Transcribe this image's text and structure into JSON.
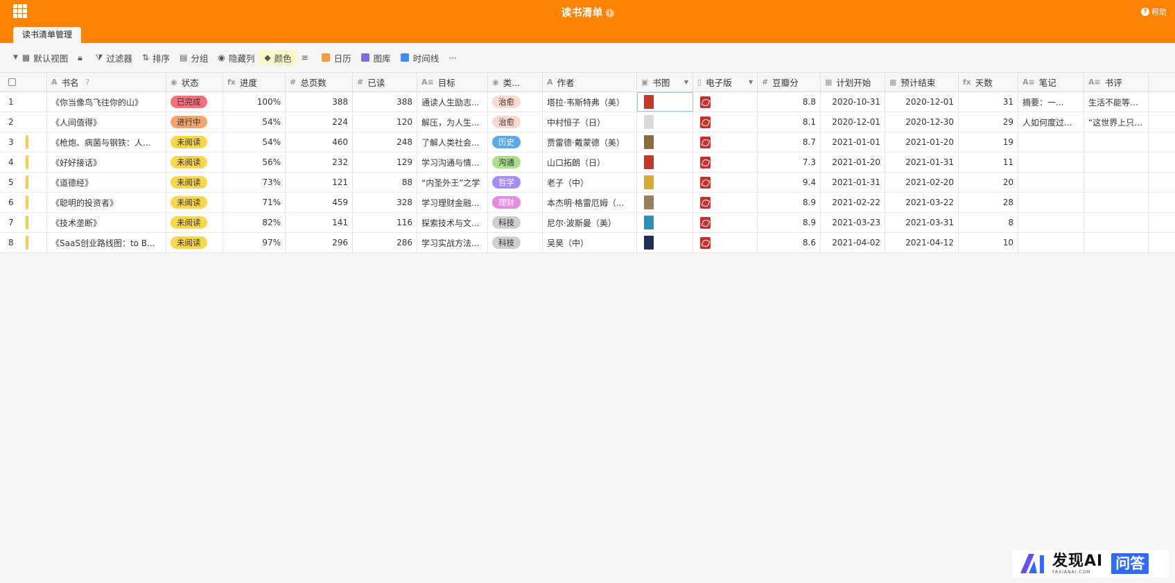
{
  "app": {
    "title": "读书清单",
    "help": "帮助"
  },
  "sheet_tab": "读书清单管理",
  "toolbar": {
    "view": "默认视图",
    "filter": "过滤器",
    "sort": "排序",
    "group": "分组",
    "hide": "隐藏列",
    "color": "颜色",
    "calendar": "日历",
    "gallery": "图库",
    "timeline": "时间线",
    "more": "···"
  },
  "columns": [
    "书名",
    "状态",
    "进度",
    "总页数",
    "已读",
    "目标",
    "类...",
    "作者",
    "书图",
    "电子版",
    "豆瓣分",
    "计划开始",
    "预计结束",
    "天数",
    "笔记",
    "书评"
  ],
  "column_icons": [
    "A",
    "◉",
    "fx",
    "#",
    "#",
    "A≡",
    "◉",
    "A",
    "▣",
    "▯",
    "#",
    "▦",
    "▦",
    "fx",
    "A≡",
    "A≡"
  ],
  "rows": [
    {
      "n": "1",
      "name": "《你当像鸟飞往你的山》",
      "status": "已完成",
      "status_color": "#f4707d",
      "progress": "100%",
      "pages": "388",
      "read": "388",
      "goal": "通读人生励志...",
      "cat": "治愈",
      "cat_color": "#fcd9cf",
      "author": "塔拉·韦斯特弗（美）",
      "thumb": "#c0392b",
      "score": "8.8",
      "start": "2020-10-31",
      "end": "2020-12-01",
      "days": "31",
      "notes": "摘要：一...",
      "review": "生活不能等待别...",
      "mark": false
    },
    {
      "n": "2",
      "name": "《人间值得》",
      "status": "进行中",
      "status_color": "#f4a46c",
      "progress": "54%",
      "pages": "224",
      "read": "120",
      "goal": "解压，为人生...",
      "cat": "治愈",
      "cat_color": "#fcd9cf",
      "author": "中村恒子（日）",
      "thumb": "#d9d9d9",
      "score": "8.1",
      "start": "2020-12-01",
      "end": "2020-12-30",
      "days": "29",
      "notes": "人如何度过...",
      "review": "“这世界上只有...",
      "mark": false
    },
    {
      "n": "3",
      "name": "《枪炮、病菌与钢铁：人...",
      "status": "未阅读",
      "status_color": "#f8d64e",
      "progress": "54%",
      "pages": "460",
      "read": "248",
      "goal": "了解人类社会...",
      "cat": "历史",
      "cat_color": "#5aa9e8",
      "author": "贾雷德·戴蒙德（美）",
      "thumb": "#8a6d3b",
      "score": "8.7",
      "start": "2021-01-01",
      "end": "2021-01-20",
      "days": "19",
      "notes": "",
      "review": "",
      "mark": true
    },
    {
      "n": "4",
      "name": "《好好接话》",
      "status": "未阅读",
      "status_color": "#f8d64e",
      "progress": "56%",
      "pages": "232",
      "read": "129",
      "goal": "学习沟通与情...",
      "cat": "沟通",
      "cat_color": "#a8e08a",
      "author": "山口拓朗（日）",
      "thumb": "#c0392b",
      "score": "7.3",
      "start": "2021-01-20",
      "end": "2021-01-31",
      "days": "11",
      "notes": "",
      "review": "",
      "mark": true
    },
    {
      "n": "5",
      "name": "《道德经》",
      "status": "未阅读",
      "status_color": "#f8d64e",
      "progress": "73%",
      "pages": "121",
      "read": "88",
      "goal": "“内圣外王”之学",
      "cat": "哲学",
      "cat_color": "#a78bfa",
      "author": "老子（中）",
      "thumb": "#d4a83a",
      "score": "9.4",
      "start": "2021-01-31",
      "end": "2021-02-20",
      "days": "20",
      "notes": "",
      "review": "",
      "mark": true
    },
    {
      "n": "6",
      "name": "《聪明的投资者》",
      "status": "未阅读",
      "status_color": "#f8d64e",
      "progress": "71%",
      "pages": "459",
      "read": "328",
      "goal": "学习理财金融...",
      "cat": "理财",
      "cat_color": "#e58ae0",
      "author": "本杰明·格雷厄姆（...",
      "thumb": "#9a7e5c",
      "score": "8.9",
      "start": "2021-02-22",
      "end": "2021-03-22",
      "days": "28",
      "notes": "",
      "review": "",
      "mark": true
    },
    {
      "n": "7",
      "name": "《技术垄断》",
      "status": "未阅读",
      "status_color": "#f8d64e",
      "progress": "82%",
      "pages": "141",
      "read": "116",
      "goal": "探索技术与文...",
      "cat": "科技",
      "cat_color": "#cfcfcf",
      "author": "尼尔·波斯曼（美）",
      "thumb": "#2f8fbf",
      "score": "8.9",
      "start": "2021-03-23",
      "end": "2021-03-31",
      "days": "8",
      "notes": "",
      "review": "",
      "mark": true
    },
    {
      "n": "8",
      "name": "《SaaS创业路线图：to B...",
      "status": "未阅读",
      "status_color": "#f8d64e",
      "progress": "97%",
      "pages": "296",
      "read": "286",
      "goal": "学习实战方法...",
      "cat": "科技",
      "cat_color": "#cfcfcf",
      "author": "吴昊（中）",
      "thumb": "#1d2f5a",
      "score": "8.6",
      "start": "2021-04-02",
      "end": "2021-04-12",
      "days": "10",
      "notes": "",
      "review": "",
      "mark": true
    }
  ],
  "watermark": {
    "brand": "发现AI",
    "sub": "FAXIANAI.COM",
    "qa": "问答"
  }
}
